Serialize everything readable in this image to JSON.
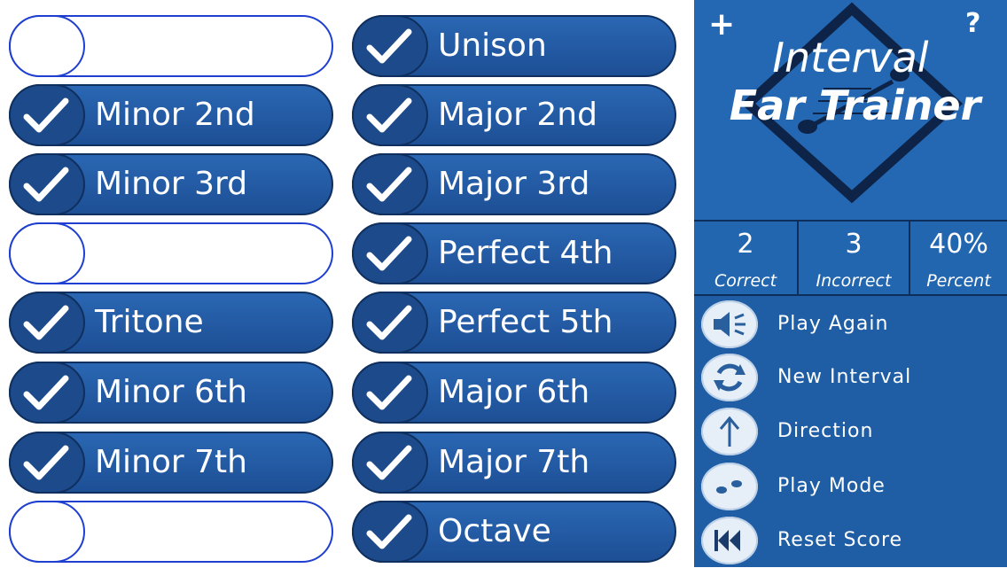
{
  "intervals": [
    {
      "label": "",
      "checked": false
    },
    {
      "label": "Unison",
      "checked": true
    },
    {
      "label": "Minor 2nd",
      "checked": true
    },
    {
      "label": "Major 2nd",
      "checked": true
    },
    {
      "label": "Minor 3rd",
      "checked": true
    },
    {
      "label": "Major 3rd",
      "checked": true
    },
    {
      "label": "",
      "checked": false
    },
    {
      "label": "Perfect 4th",
      "checked": true
    },
    {
      "label": "Tritone",
      "checked": true
    },
    {
      "label": "Perfect 5th",
      "checked": true
    },
    {
      "label": "Minor 6th",
      "checked": true
    },
    {
      "label": "Major 6th",
      "checked": true
    },
    {
      "label": "Minor 7th",
      "checked": true
    },
    {
      "label": "Major 7th",
      "checked": true
    },
    {
      "label": "",
      "checked": false
    },
    {
      "label": "Octave",
      "checked": true
    }
  ],
  "header": {
    "title_line1": "Interval",
    "title_line2": "Ear Trainer",
    "plus_icon": "plus-icon",
    "help_icon": "question-icon"
  },
  "score": {
    "correct": "2",
    "correct_label": "Correct",
    "incorrect": "3",
    "incorrect_label": "Incorrect",
    "percent": "40%",
    "percent_label": "Percent"
  },
  "actions": [
    {
      "label": "Play Again",
      "icon": "speaker-icon"
    },
    {
      "label": "New Interval",
      "icon": "refresh-icon"
    },
    {
      "label": "Direction",
      "icon": "arrow-up-icon"
    },
    {
      "label": "Play Mode",
      "icon": "two-dots-icon"
    },
    {
      "label": "Reset Score",
      "icon": "rewind-icon"
    }
  ],
  "colors": {
    "button_blue": "#2a67b3",
    "panel_blue": "#2266b0",
    "outline_blue": "#1f3fd0"
  }
}
